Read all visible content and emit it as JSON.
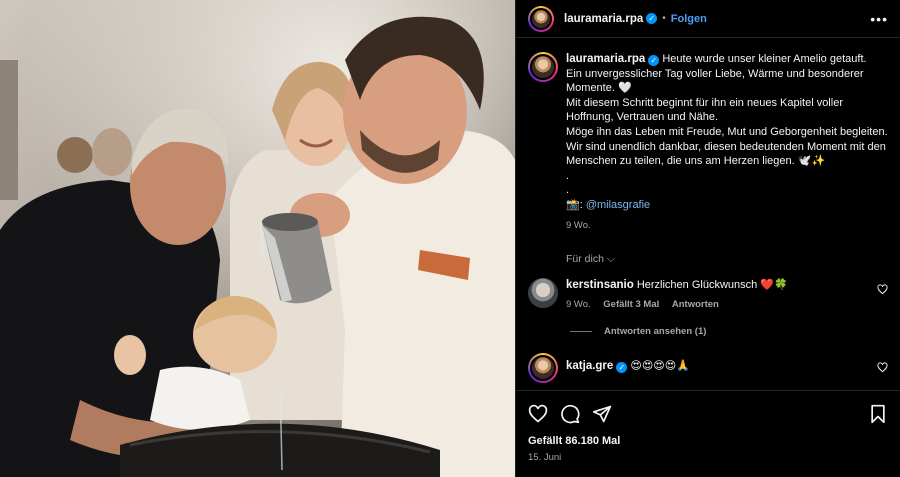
{
  "post": {
    "author": "lauramaria.rpa",
    "follow_label": "Folgen",
    "separator": "•",
    "more_label": "•••"
  },
  "caption": {
    "author": "lauramaria.rpa",
    "lines": [
      "Heute wurde unser kleiner Amelio getauft.",
      "Ein unvergesslicher Tag voller Liebe, Wärme und besonderer Momente. 🤍",
      "Mit diesem Schritt beginnt für ihn ein neues Kapitel voller Hoffnung, Vertrauen und Nähe.",
      "Möge ihn das Leben mit Freude, Mut und Geborgenheit begleiten.",
      "Wir sind unendlich dankbar, diesen bedeutenden Moment mit den Menschen zu teilen, die uns am Herzen liegen. 🕊️✨",
      ".",
      "."
    ],
    "credit_icon": "📸:",
    "credit_mention": "@milasgrafie",
    "time": "9 Wo."
  },
  "translate_label": "Für dich",
  "comments": [
    {
      "author": "kerstinsanio",
      "text": "Herzlichen Glückwunsch ❤️🍀",
      "time": "9 Wo.",
      "likes": "Gefällt 3 Mal",
      "reply": "Antworten",
      "view_replies": "Antworten ansehen (1)"
    },
    {
      "author": "katja.gre",
      "text": "😍😍😍😍🙏"
    }
  ],
  "footer": {
    "likes": "Gefällt 86.180 Mal",
    "date": "15. Juni"
  },
  "colors": {
    "link": "#4a9ff5",
    "verified": "#0095f6",
    "muted": "#a8a8a8"
  }
}
